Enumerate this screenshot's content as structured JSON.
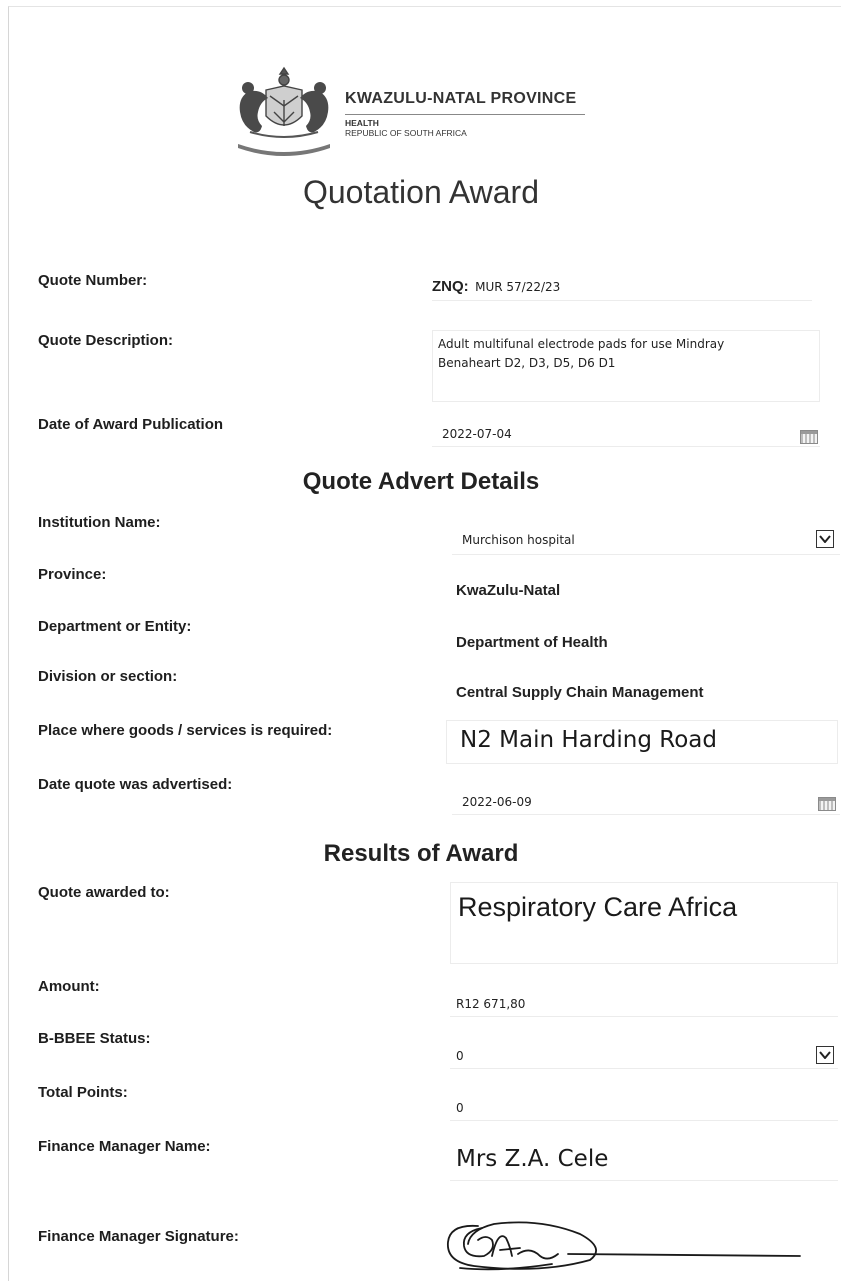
{
  "header": {
    "province": "KWAZULU-NATAL PROVINCE",
    "department": "HEALTH",
    "country": "REPUBLIC OF SOUTH AFRICA",
    "title": "Quotation Award"
  },
  "quote": {
    "number_label": "Quote Number:",
    "number_prefix": "ZNQ:",
    "number_value": "MUR 57/22/23",
    "description_label": "Quote Description:",
    "description_line1": "Adult multifunal electrode pads for use Mindray",
    "description_line2": "Benaheart D2, D3, D5, D6 D1",
    "award_date_label": "Date of Award Publication",
    "award_date_value": "2022-07-04"
  },
  "advert": {
    "heading": "Quote Advert Details",
    "institution_label": "Institution Name:",
    "institution_value": "Murchison hospital",
    "province_label": "Province:",
    "province_value": "KwaZulu-Natal",
    "department_label": "Department or Entity:",
    "department_value": "Department of Health",
    "division_label": "Division or section:",
    "division_value": "Central Supply Chain Management",
    "place_label": "Place where goods /  services is required:",
    "place_value": "N2 Main Harding Road",
    "advertised_label": "Date quote was advertised:",
    "advertised_value": "2022-06-09"
  },
  "results": {
    "heading": "Results of Award",
    "awarded_label": "Quote awarded to:",
    "awarded_value": "Respiratory Care Africa",
    "amount_label": "Amount:",
    "amount_value": "R12 671,80",
    "bbbee_label": "B-BBEE Status:",
    "bbbee_value": "0",
    "points_label": "Total Points:",
    "points_value": "0",
    "fm_name_label": "Finance Manager Name:",
    "fm_name_value": "Mrs Z.A. Cele",
    "fm_signature_label": "Finance Manager Signature:"
  },
  "icons": {
    "crest": "kzn-coat-of-arms-icon",
    "calendar": "calendar-icon",
    "dropdown": "dropdown-arrow-icon",
    "signature": "handwritten-signature"
  }
}
